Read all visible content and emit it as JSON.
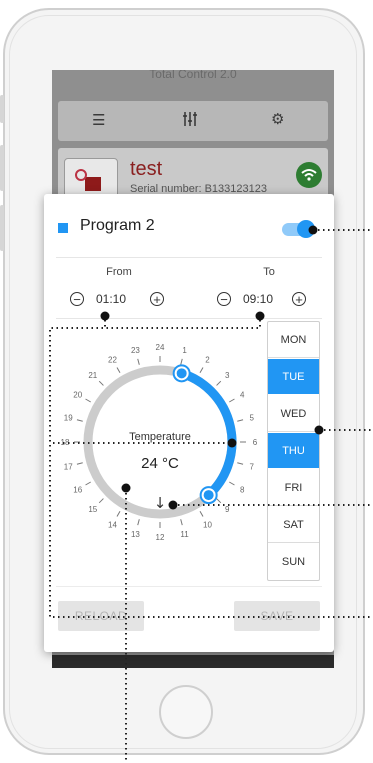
{
  "app": {
    "title": "Total Control 2.0",
    "device": {
      "name": "test",
      "serial": "Serial number: B133123123"
    }
  },
  "icons": {
    "toolbar_list": "list-icon",
    "toolbar_sliders": "sliders-icon",
    "toolbar_settings": "gear-icon",
    "wifi": "wifi-icon",
    "thumb": "device-thumbnail-icon",
    "minus": "minus-icon",
    "plus": "plus-icon",
    "direction": "arrow-down-icon"
  },
  "colors": {
    "accent": "#2196f3",
    "toggle_track": "#90caf9",
    "device_name": "#8a1f1f",
    "wifi_badge": "#2e7d32"
  },
  "dialog": {
    "program_title": "Program 2",
    "program_enabled": true,
    "from": {
      "label": "From",
      "time": "01:10"
    },
    "to": {
      "label": "To",
      "time": "09:10"
    },
    "dial": {
      "hours": [
        "24",
        "1",
        "2",
        "3",
        "4",
        "5",
        "6",
        "7",
        "8",
        "9",
        "10",
        "11",
        "12",
        "13",
        "14",
        "15",
        "16",
        "17",
        "18",
        "19",
        "20",
        "21",
        "22",
        "23"
      ],
      "temperature_label": "Temperature",
      "temperature_value": "24 °C",
      "direction_glyph": "↓"
    },
    "days": [
      {
        "label": "MON",
        "selected": false
      },
      {
        "label": "TUE",
        "selected": true
      },
      {
        "label": "WED",
        "selected": false
      },
      {
        "label": "THU",
        "selected": true
      },
      {
        "label": "FRI",
        "selected": false
      },
      {
        "label": "SAT",
        "selected": false
      },
      {
        "label": "SUN",
        "selected": false
      }
    ],
    "reload_label": "RELOAD",
    "save_label": "SAVE"
  }
}
